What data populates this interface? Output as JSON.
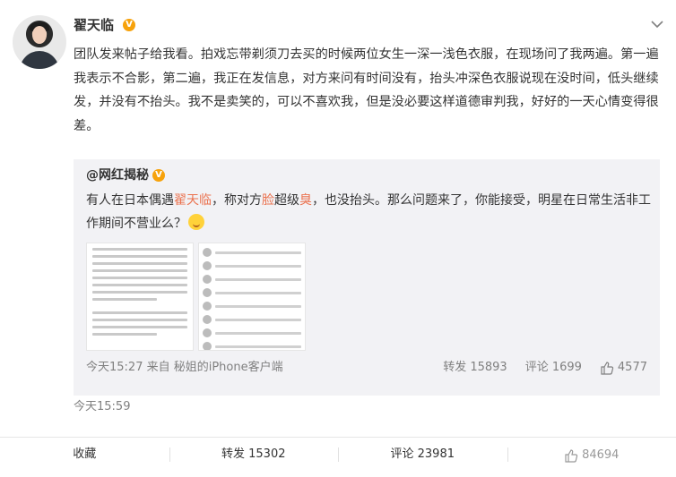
{
  "post": {
    "username": "翟天临",
    "verified_badge": "V",
    "text": "团队发来帖子给我看。拍戏忘带剃须刀去买的时候两位女生一深一浅色衣服，在现场问了我两遍。第一遍我表示不合影，第二遍，我正在发信息，对方来问有时间没有，抬头冲深色衣服说现在没时间，低头继续发，并没有不抬头。我不是卖笑的，可以不喜欢我，但是没必要这样道德审判我，好好的一天心情变得很差。",
    "time": "今天15:59"
  },
  "repost": {
    "username": "@网红揭秘",
    "verified_badge": "V",
    "text_parts": {
      "p1": "有人在日本偶遇",
      "p2": "翟天临",
      "p3": "，称对方",
      "p4": "脸",
      "p5": "超级",
      "p6": "臭",
      "p7": "，也没抬头。那么问题来了，你能接受，明星在日常生活非工作期间不营业么？"
    },
    "meta": "今天15:27 来自 秘姐的iPhone客户端",
    "forward": "转发 15893",
    "comment": "评论 1699",
    "likes": "4577"
  },
  "bottom_bar": {
    "favorite": "收藏",
    "forward": "转发 15302",
    "comment": "评论 23981",
    "likes": "84694"
  },
  "colors": {
    "highlight": "#eb7350",
    "badge": "#f7a20b",
    "meta_gray": "#808080",
    "repost_bg": "#f2f2f5"
  },
  "icons": [
    "more-chevron-icon",
    "verified-icon",
    "thumbs-up-icon",
    "emoji-icon"
  ]
}
